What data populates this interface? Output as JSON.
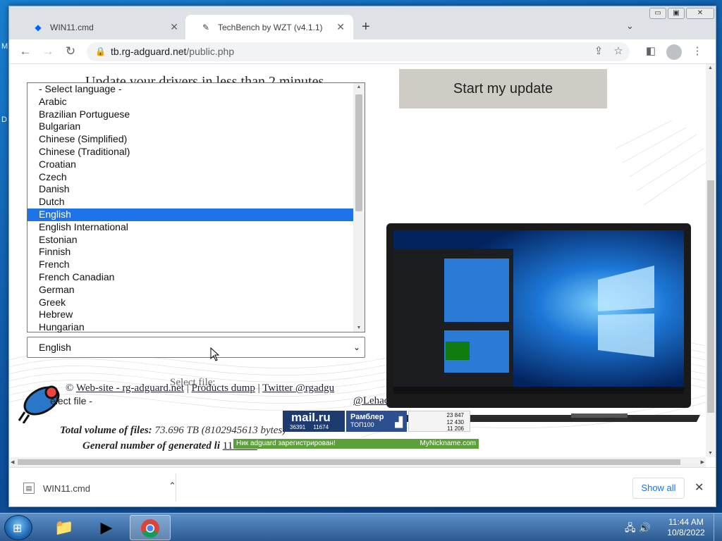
{
  "desktop": {
    "labels": [
      "M",
      "D"
    ]
  },
  "browser": {
    "tabs": [
      {
        "title": "WIN11.cmd",
        "icon": "dropbox-icon",
        "active": false
      },
      {
        "title": "TechBench by WZT (v4.1.1)",
        "icon": "feather-icon",
        "active": true
      }
    ],
    "window_buttons": {
      "minimize": "▭",
      "maximize": "▣",
      "close": "✕"
    },
    "url": {
      "domain": "tb.rg-adguard.net",
      "path": "/public.php"
    }
  },
  "page": {
    "ad_headline": "Update your drivers in less than 2 minutes",
    "start_update_button": "Start my update",
    "language_select": {
      "selected_value": "English",
      "options": [
        "- Select language -",
        "Arabic",
        "Brazilian Portuguese",
        "Bulgarian",
        "Chinese (Simplified)",
        "Chinese (Traditional)",
        "Croatian",
        "Czech",
        "Danish",
        "Dutch",
        "English",
        "English International",
        "Estonian",
        "Finnish",
        "French",
        "French Canadian",
        "German",
        "Greek",
        "Hebrew",
        "Hungarian"
      ],
      "highlighted_index": 10
    },
    "select_file_label": "Select file:",
    "select_file_value": "elect file -",
    "footer": {
      "copyright": "©",
      "website_link": "Web-site - rg-adguard.net",
      "sep1": "|",
      "products_link": "Products dump",
      "sep2": "|",
      "twitter_link": "Twitter @rgadgu",
      "lehac": "@Lehac"
    },
    "total_volume": {
      "label": "Total volume of files:",
      "value": "73.696 TB",
      "bytes": "(8102945613",
      "bytes_tail": "bytes)"
    },
    "generated": {
      "label": "General number of generated li",
      "value": "1111111"
    },
    "counters": {
      "mailru": {
        "brand": "mail.ru",
        "n1": "36391",
        "n2": "11674"
      },
      "rambler": {
        "brand": "Рамблер",
        "sub": "ТОП100"
      },
      "li": {
        "row1": "23 847",
        "row2": "12 430",
        "row3": "11 206"
      }
    },
    "nickname_bar": {
      "text": "Ник adguard зарегистрирован!",
      "brand": "MyNickname.com"
    }
  },
  "downloads": {
    "file": "WIN11.cmd",
    "show_all": "Show all"
  },
  "taskbar": {
    "clock_time": "11:44 AM",
    "clock_date": "10/8/2022"
  },
  "colors": {
    "highlight": "#1e73e8",
    "start_button_bg": "#cfcbc5",
    "nick_bar": "#5ba03a",
    "mailru": "#1d3b6e"
  }
}
